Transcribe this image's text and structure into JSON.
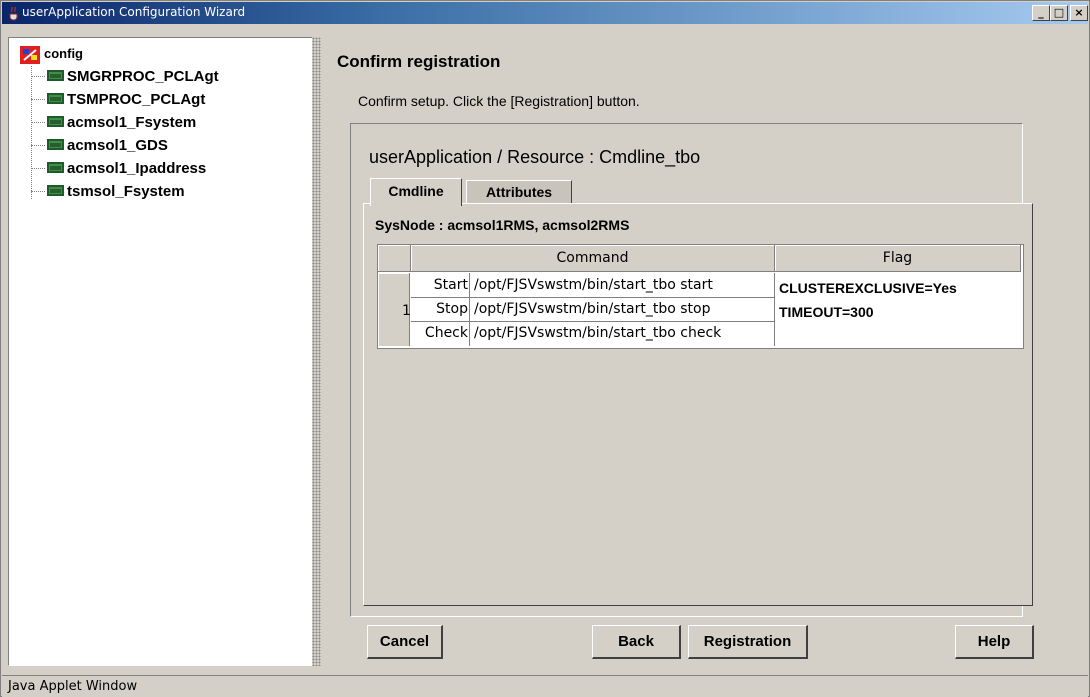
{
  "window": {
    "title": "userApplication Configuration Wizard",
    "minimize_glyph": "_",
    "maximize_glyph": "□",
    "close_glyph": "×"
  },
  "tree": {
    "root_label": "config",
    "items": [
      {
        "label": "SMGRPROC_PCLAgt"
      },
      {
        "label": "TSMPROC_PCLAgt"
      },
      {
        "label": "acmsol1_Fsystem"
      },
      {
        "label": "acmsol1_GDS"
      },
      {
        "label": "acmsol1_Ipaddress"
      },
      {
        "label": "tsmsol_Fsystem"
      }
    ]
  },
  "main": {
    "heading": "Confirm registration",
    "instruction": "Confirm setup.  Click the [Registration] button.",
    "resource_line": "userApplication / Resource   :   Cmdline_tbo",
    "tabs": [
      {
        "label": "Cmdline",
        "active": true
      },
      {
        "label": "Attributes",
        "active": false
      }
    ],
    "sysnode": "SysNode : acmsol1RMS, acmsol2RMS",
    "table": {
      "headers": {
        "command": "Command",
        "flag": "Flag"
      },
      "row_number": "1",
      "commands": [
        {
          "type": "Start",
          "path": "/opt/FJSVswstm/bin/start_tbo start"
        },
        {
          "type": "Stop",
          "path": "/opt/FJSVswstm/bin/start_tbo stop"
        },
        {
          "type": "Check",
          "path": "/opt/FJSVswstm/bin/start_tbo check"
        }
      ],
      "flags": [
        "CLUSTEREXCLUSIVE=Yes",
        "TIMEOUT=300"
      ]
    }
  },
  "buttons": {
    "cancel": "Cancel",
    "back": "Back",
    "registration": "Registration",
    "help": "Help"
  },
  "status_bar": "Java Applet Window"
}
